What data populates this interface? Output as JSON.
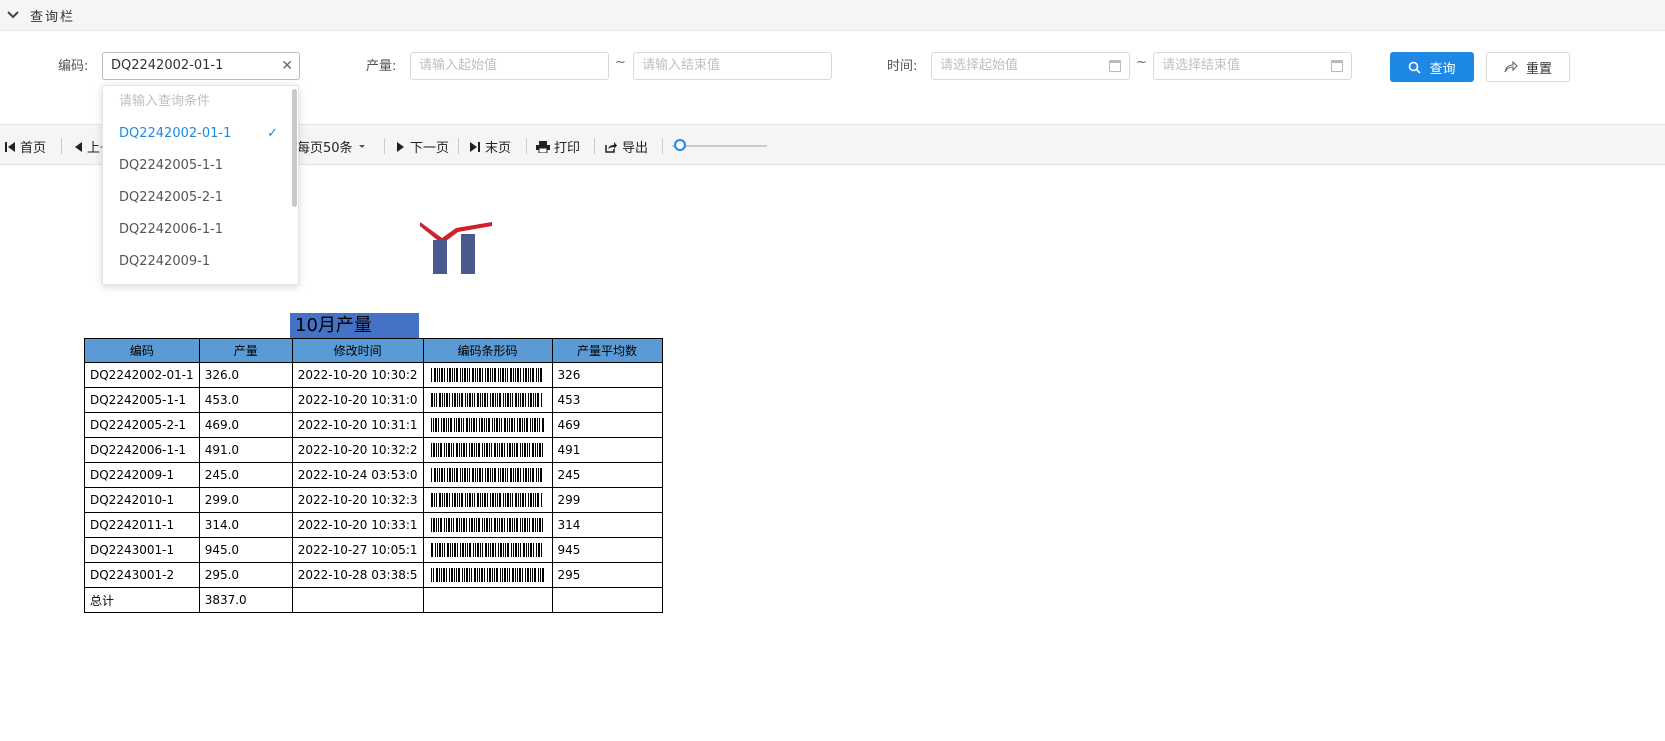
{
  "header": {
    "title": "查询栏"
  },
  "form": {
    "code_label": "编码:",
    "code_value": "DQ2242002-01-1",
    "qty_label": "产量:",
    "qty_start_placeholder": "请输入起始值",
    "qty_end_placeholder": "请输入结束值",
    "tilde": "~",
    "time_label": "时间:",
    "time_start_placeholder": "请选择起始值",
    "time_end_placeholder": "请选择结束值",
    "query_button": "查询",
    "reset_button": "重置"
  },
  "dropdown": {
    "search_placeholder": "请输入查询条件",
    "options": [
      "DQ2242002-01-1",
      "DQ2242005-1-1",
      "DQ2242005-2-1",
      "DQ2242006-1-1",
      "DQ2242009-1"
    ],
    "selected": "DQ2242002-01-1"
  },
  "toolbar": {
    "first": "首页",
    "prev": "上一页",
    "page_size": "每页50条",
    "next": "下一页",
    "last": "末页",
    "print": "打印",
    "export": "导出",
    "zoom_level": 0.05
  },
  "report": {
    "title": "10月产量",
    "columns": [
      "编码",
      "产量",
      "修改时间",
      "编码条形码",
      "产量平均数"
    ],
    "rows": [
      [
        "DQ2242002-01-1",
        "326.0",
        "2022-10-20 10:30:2",
        "",
        "326"
      ],
      [
        "DQ2242005-1-1",
        "453.0",
        "2022-10-20 10:31:0",
        "",
        "453"
      ],
      [
        "DQ2242005-2-1",
        "469.0",
        "2022-10-20 10:31:1",
        "",
        "469"
      ],
      [
        "DQ2242006-1-1",
        "491.0",
        "2022-10-20 10:32:2",
        "",
        "491"
      ],
      [
        "DQ2242009-1",
        "245.0",
        "2022-10-24 03:53:0",
        "",
        "245"
      ],
      [
        "DQ2242010-1",
        "299.0",
        "2022-10-20 10:32:3",
        "",
        "299"
      ],
      [
        "DQ2242011-1",
        "314.0",
        "2022-10-20 10:33:1",
        "",
        "314"
      ],
      [
        "DQ2243001-1",
        "945.0",
        "2022-10-27 10:05:1",
        "",
        "945"
      ],
      [
        "DQ2243001-2",
        "295.0",
        "2022-10-28 03:38:5",
        "",
        "295"
      ]
    ],
    "total_label": "总计",
    "total_value": "3837.0"
  },
  "colors": {
    "accent": "#1e88e5",
    "header_fill": "#5b9bd5",
    "title_fill": "#4472c4",
    "logo_red": "#d0202a",
    "logo_blue": "#4a5a8c"
  }
}
